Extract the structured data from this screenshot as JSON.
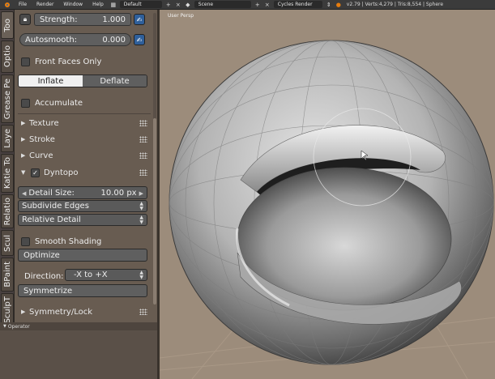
{
  "header": {
    "menus": [
      "File",
      "Render",
      "Window",
      "Help"
    ],
    "layout": "Default",
    "scene": "Scene",
    "engine": "Cycles Render",
    "stats": "v2.79 | Verts:4,279 | Tris:8,554 | Sphere"
  },
  "tabs": [
    "Too",
    "Optio",
    "Grease Pe",
    "Laye",
    "Katie To",
    "Relatio",
    "Scul",
    "BPaint",
    "SculpT"
  ],
  "brush": {
    "strength_label": "Strength:",
    "strength_value": "1.000",
    "autosmooth_label": "Autosmooth:",
    "autosmooth_value": "0.000",
    "front_faces_only": "Front Faces Only",
    "inflate": "Inflate",
    "deflate": "Deflate",
    "accumulate": "Accumulate"
  },
  "subpanels": {
    "texture": "Texture",
    "stroke": "Stroke",
    "curve": "Curve",
    "dyntopo": "Dyntopo",
    "symmetry": "Symmetry/Lock"
  },
  "dyntopo": {
    "detail_size_label": "Detail Size:",
    "detail_size_value": "10.00 px",
    "subdivide": "Subdivide Edges",
    "detail_mode": "Relative Detail",
    "smooth_shading": "Smooth Shading",
    "optimize": "Optimize"
  },
  "symmetry_panel": {
    "direction_label": "Direction:",
    "direction_value": "-X to +X",
    "symmetrize": "Symmetrize"
  },
  "operator": "Operator",
  "viewport": {
    "label": "User Persp"
  }
}
